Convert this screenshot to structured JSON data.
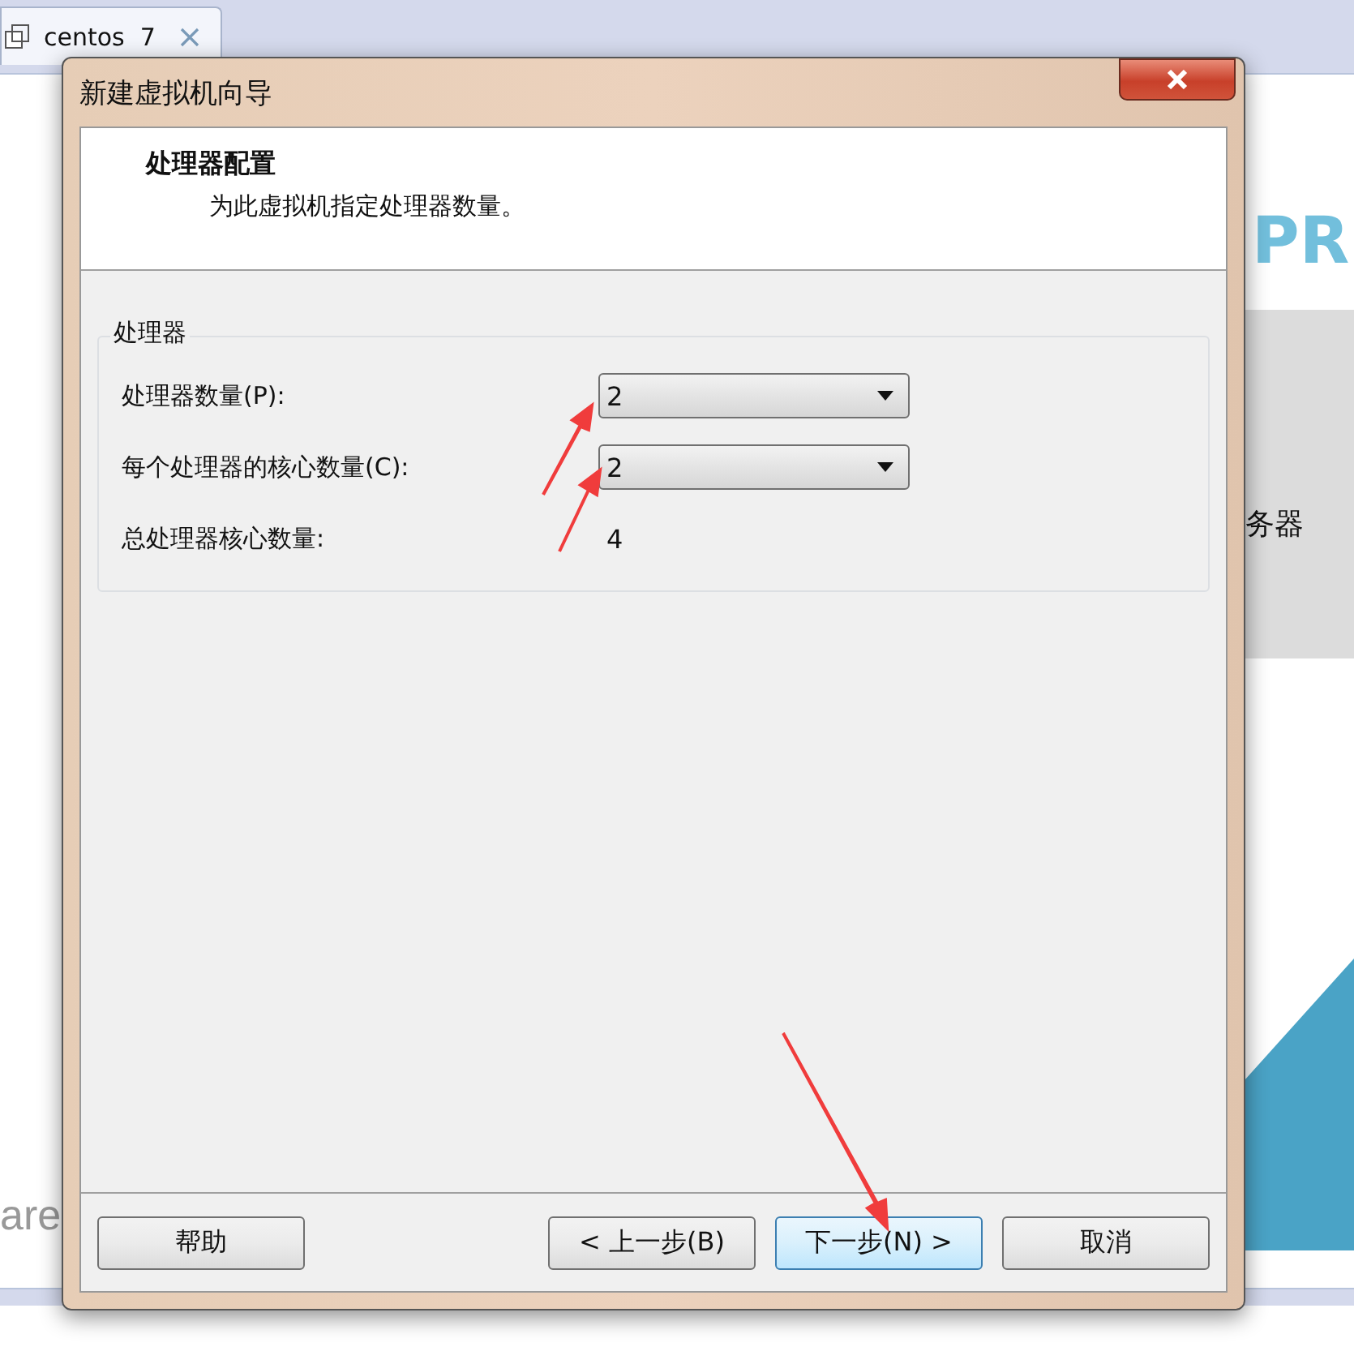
{
  "app_tab": {
    "label": "centos  7"
  },
  "background": {
    "logo_fragment": "PR",
    "panel_text": "务器",
    "brand_fragment": "are"
  },
  "dialog": {
    "title": "新建虚拟机向导",
    "header": {
      "title": "处理器配置",
      "subtitle": "为此虚拟机指定处理器数量。"
    },
    "group": {
      "title": "处理器",
      "fields": [
        {
          "label": "处理器数量(P):",
          "kind": "dropdown",
          "value": "2"
        },
        {
          "label": "每个处理器的核心数量(C):",
          "kind": "dropdown",
          "value": "2"
        },
        {
          "label": "总处理器核心数量:",
          "kind": "text",
          "value": "4"
        }
      ]
    },
    "buttons": [
      {
        "label": "帮助",
        "selected": false
      },
      {
        "label": "< 上一步(B)",
        "selected": false
      },
      {
        "label": "下一步(N) >",
        "selected": true
      },
      {
        "label": "取消",
        "selected": false
      }
    ]
  }
}
